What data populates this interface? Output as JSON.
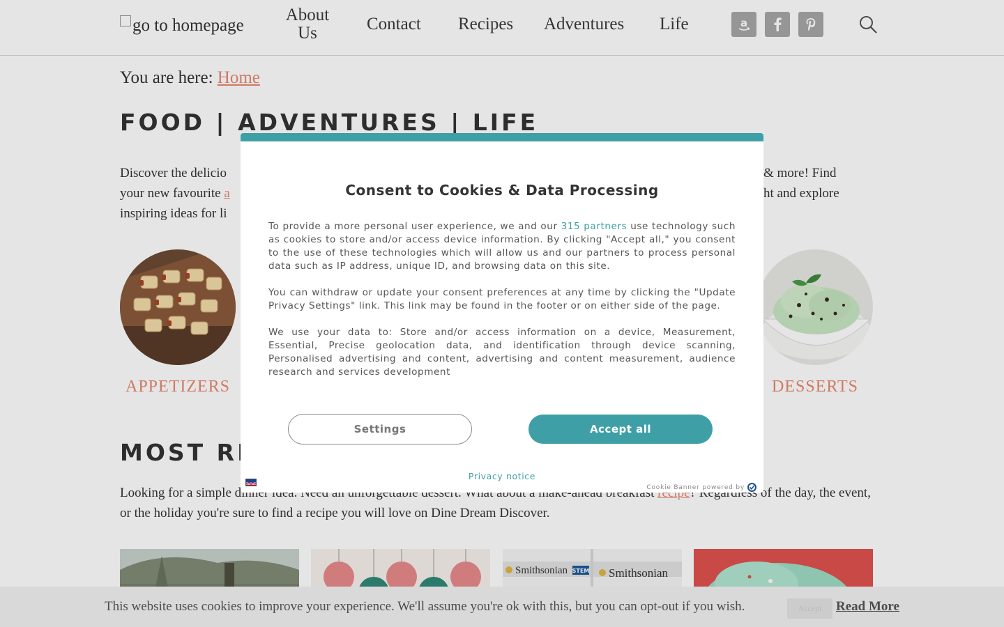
{
  "header": {
    "logo_alt": "go to homepage",
    "nav": [
      "About Us",
      "Contact",
      "Recipes",
      "Adventures",
      "Life"
    ],
    "social": [
      "amazon-icon",
      "facebook-icon",
      "pinterest-icon"
    ],
    "search_icon": "search-icon"
  },
  "breadcrumb": {
    "prefix": "You are here:",
    "home": "Home"
  },
  "tagline": "FOOD | ADVENTURES | LIFE",
  "intro": {
    "line1_start": "Discover the delicio",
    "line1_end": " & more! Find",
    "line2_start": "your new favourite ",
    "line2_link": "a",
    "line2_end": "ht and explore",
    "line3": "inspiring ideas for li"
  },
  "categories": [
    {
      "label": "APPETIZERS"
    },
    {
      "label": "DESSERTS"
    }
  ],
  "most_recent": {
    "title": "MOST RE",
    "text_start": "Looking for a simple dinner idea. Need an unforgettable dessert. What about a make-ahead breakfast ",
    "text_link": "recipe",
    "text_end": "? Regardless of the day, the event, or the holiday you're sure to find a recipe you will love on Dine Dream Discover."
  },
  "thumbnails": [
    {
      "alt": "outdoor-tree-photo"
    },
    {
      "alt": "holiday-ornaments-photo"
    },
    {
      "alt": "smithsonian-kits-photo",
      "text1": "Smithsonian",
      "text2": "Smithsonian",
      "badge": "STEM"
    },
    {
      "alt": "mint-cookies-photo"
    }
  ],
  "cookie_bar": {
    "text": "This website uses cookies to improve your experience. We'll assume you're ok with this, but you can opt-out if you wish.",
    "accept": "Accept",
    "read_more": "Read More"
  },
  "consent": {
    "title": "Consent to Cookies & Data Processing",
    "p1_start": "To provide a more personal user experience, we and our ",
    "p1_link": "315 partners",
    "p1_end": " use technology such as cookies to store and/or access device information. By clicking \"Accept all,\" you consent to the use of these technologies which will allow us and our partners to process personal data such as IP address, unique ID, and browsing data on this site.",
    "p2": "You can withdraw or update your consent preferences at any time by clicking the \"Update Privacy Settings\" link. This link may be found in the footer or on either side of the page.",
    "p3": "We use your data to: Store and/or access information on a device, Measurement, Essential, Precise geolocation data, and identification through device scanning, Personalised advertising and content, advertising and content measurement, audience research and services development",
    "settings_button": "Settings",
    "accept_button": "Accept all",
    "privacy_notice": "Privacy notice",
    "powered_by": "Cookie Banner powered by",
    "accent_color": "#3ea0a6"
  }
}
